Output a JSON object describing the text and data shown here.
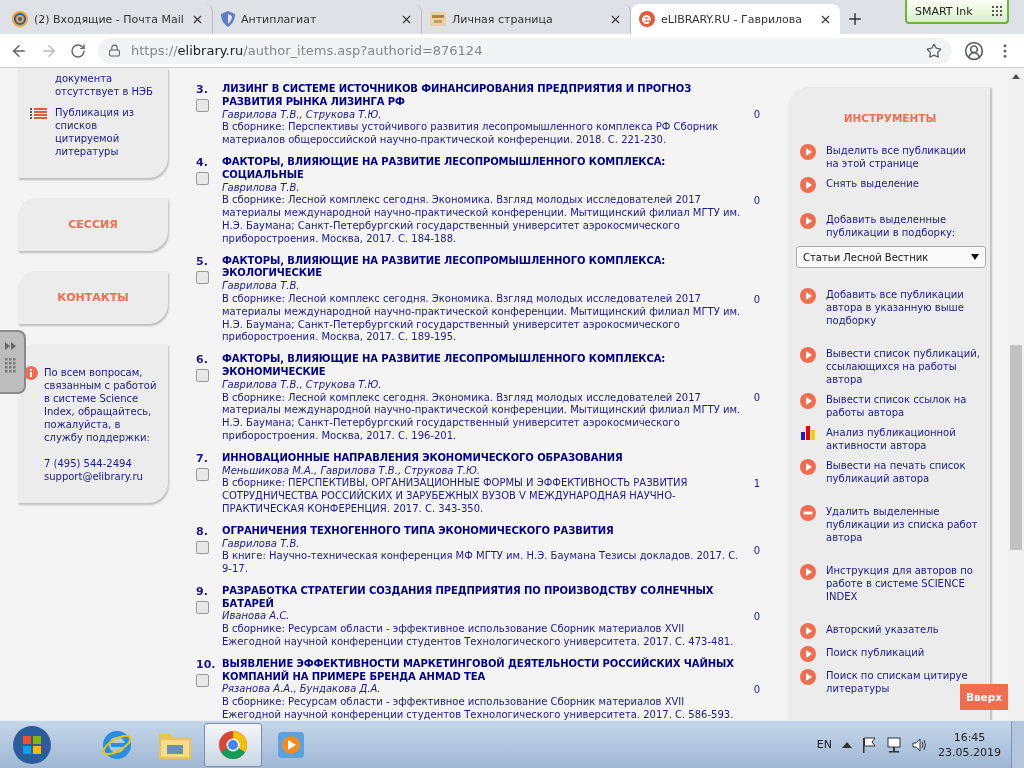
{
  "browser": {
    "tabs": [
      {
        "title": "(2) Входящие - Почта Mail",
        "kind": "mail",
        "selected": false
      },
      {
        "title": "Антиплагиат",
        "kind": "shield",
        "selected": false
      },
      {
        "title": "Личная страница",
        "kind": "image",
        "selected": false
      },
      {
        "title": "eLIBRARY.RU - Гаврилова",
        "kind": "elibrary",
        "selected": true
      }
    ],
    "url": {
      "scheme": "https://",
      "host": "elibrary.ru",
      "path": "/author_items.asp?authorid=876124"
    }
  },
  "smart_ink": {
    "label": "SMART Ink"
  },
  "sidebar": {
    "legend": [
      {
        "kind": "text",
        "text": "документа отсутствует в НЭБ"
      },
      {
        "kind": "list",
        "text": "Публикация из списков цитируемой литературы"
      }
    ],
    "menu": [
      {
        "label": "СЕССИЯ"
      },
      {
        "label": "КОНТАКТЫ"
      }
    ],
    "support": {
      "text": "По всем вопросам, связанным с работой в системе Science Index, обращайтесь, пожалуйста, в службу поддержки:",
      "phone": "7 (495) 544-2494",
      "email": "support@elibrary.ru"
    }
  },
  "publications": [
    {
      "number": "3.",
      "title": "ЛИЗИНГ В СИСТЕМЕ ИСТОЧНИКОВ ФИНАНСИРОВАНИЯ ПРЕДПРИЯТИЯ И ПРОГНОЗ РАЗВИТИЯ РЫНКА ЛИЗИНГА РФ",
      "authors": "Гаврилова Т.В., Струкова Т.Ю.",
      "source": "В сборнике: Перспективы устойчивого развития лесопромышленного комплекса РФ Сборник материалов общероссийской научно-практической конференции. 2018. С. 221-230.",
      "citations": "0",
      "checked": false
    },
    {
      "number": "4.",
      "title": "ФАКТОРЫ, ВЛИЯЮЩИЕ НА РАЗВИТИЕ ЛЕСОПРОМЫШЛЕННОГО КОМПЛЕКСА: СОЦИАЛЬНЫЕ",
      "authors": "Гаврилова Т.В.",
      "source": "В сборнике: Лесной комплекс сегодня. Экономика. Взгляд молодых исследователей 2017 материалы международной научно-практической конференции. Мытищинский филиал МГТУ им. Н.Э. Баумана; Санкт-Петербургский государственный университет аэрокосмического приборостроения. Москва, 2017. С. 184-188.",
      "citations": "0",
      "checked": false
    },
    {
      "number": "5.",
      "title": "ФАКТОРЫ, ВЛИЯЮЩИЕ НА РАЗВИТИЕ ЛЕСОПРОМЫШЛЕННОГО КОМПЛЕКСА: ЭКОЛОГИЧЕСКИЕ",
      "authors": "Гаврилова Т.В.",
      "source": "В сборнике: Лесной комплекс сегодня. Экономика. Взгляд молодых исследователей 2017 материалы международной научно-практической конференции. Мытищинский филиал МГТУ им. Н.Э. Баумана; Санкт-Петербургский государственный университет аэрокосмического приборостроения. Москва, 2017. С. 189-195.",
      "citations": "0",
      "checked": false
    },
    {
      "number": "6.",
      "title": "ФАКТОРЫ, ВЛИЯЮЩИЕ НА РАЗВИТИЕ ЛЕСОПРОМЫШЛЕННОГО КОМПЛЕКСА: ЭКОНОМИЧЕСКИЕ",
      "authors": "Гаврилова Т.В., Струкова Т.Ю.",
      "source": "В сборнике: Лесной комплекс сегодня. Экономика. Взгляд молодых исследователей 2017 материалы международной научно-практической конференции. Мытищинский филиал МГТУ им. Н.Э. Баумана; Санкт-Петербургский государственный университет аэрокосмического приборостроения. Москва, 2017. С. 196-201.",
      "citations": "0",
      "checked": false
    },
    {
      "number": "7.",
      "title": "ИННОВАЦИОННЫЕ НАПРАВЛЕНИЯ ЭКОНОМИЧЕСКОГО ОБРАЗОВАНИЯ",
      "authors": "Меньшикова М.А., Гаврилова Т.В., Струкова Т.Ю.",
      "source": "В сборнике: ПЕРСПЕКТИВЫ, ОРГАНИЗАЦИОННЫЕ ФОРМЫ И ЭФФЕКТИВНОСТЬ РАЗВИТИЯ СОТРУДНИЧЕСТВА РОССИЙСКИХ И ЗАРУБЕЖНЫХ ВУЗОВ V МЕЖДУНАРОДНАЯ НАУЧНО-ПРАКТИЧЕСКАЯ КОНФЕРЕНЦИЯ. 2017. С. 343-350.",
      "citations": "1",
      "checked": false
    },
    {
      "number": "8.",
      "title": "ОГРАНИЧЕНИЯ ТЕХНОГЕННОГО ТИПА ЭКОНОМИЧЕСКОГО РАЗВИТИЯ",
      "authors": "Гаврилова Т.В.",
      "source": "В книге: Научно-техническая конференция МФ МГТУ им. Н.Э. Баумана Тезисы докладов. 2017. С. 9-17.",
      "citations": "0",
      "checked": false
    },
    {
      "number": "9.",
      "title": "РАЗРАБОТКА СТРАТЕГИИ СОЗДАНИЯ ПРЕДПРИЯТИЯ ПО ПРОИЗВОДСТВУ СОЛНЕЧНЫХ БАТАРЕЙ",
      "authors": "Иванова А.С.",
      "source": "В сборнике: Ресурсам области - эффективное использование Сборник материалов XVII Ежегодной научной конференции студентов Технологического университета. 2017. С. 473-481.",
      "citations": "0",
      "checked": false
    },
    {
      "number": "10.",
      "title": "ВЫЯВЛЕНИЕ ЭФФЕКТИВНОСТИ МАРКЕТИНГОВОЙ ДЕЯТЕЛЬНОСТИ РОССИЙСКИХ ЧАЙНЫХ КОМПАНИЙ НА ПРИМЕРЕ БРЕНДА AHMAD TEA",
      "authors": "Рязанова А.А., Бундакова Д.А.",
      "source": "В сборнике: Ресурсам области - эффективное использование Сборник материалов XVII Ежегодной научной конференции студентов Технологического университета. 2017. С. 586-593.",
      "citations": "0",
      "checked": false
    }
  ],
  "tools": {
    "title": "ИНСТРУМЕНТЫ",
    "groups": [
      {
        "items": [
          {
            "kind": "play",
            "text": "Выделить все публикации на этой странице"
          },
          {
            "kind": "play",
            "text": "Снять выделение"
          }
        ]
      },
      {
        "items": [
          {
            "kind": "play",
            "text": "Добавить выделенные публикации в подборку:"
          },
          {
            "kind": "select",
            "text": "Статьи Лесной Вестник"
          }
        ]
      },
      {
        "items": [
          {
            "kind": "play",
            "text": "Добавить все публикации автора в указанную выше подборку"
          }
        ]
      },
      {
        "items": [
          {
            "kind": "play",
            "text": "Вывести список публикаций, ссылающихся на работы автора"
          },
          {
            "kind": "play",
            "text": "Вывести список ссылок на работы автора"
          },
          {
            "kind": "chart",
            "text": "Анализ публикационной активности автора"
          },
          {
            "kind": "play",
            "text": "Вывести на печать список публикаций автора"
          }
        ]
      },
      {
        "items": [
          {
            "kind": "minus",
            "text": "Удалить выделенные публикации из списка работ автора"
          }
        ]
      },
      {
        "items": [
          {
            "kind": "play",
            "text": "Инструкция для авторов по работе в системе SCIENCE INDEX"
          }
        ]
      },
      {
        "items": [
          {
            "kind": "play",
            "text": "Авторский указатель"
          },
          {
            "kind": "play",
            "text": "Поиск публикаций"
          },
          {
            "kind": "play",
            "text": "Поиск по спискам цитируе\nлитературы"
          }
        ]
      }
    ]
  },
  "scroll_top_button": "Вверх",
  "taskbar": {
    "apps": [
      {
        "kind": "ie",
        "selected": false
      },
      {
        "kind": "folder",
        "selected": false
      },
      {
        "kind": "chrome",
        "selected": true
      },
      {
        "kind": "player",
        "selected": false
      }
    ],
    "language": "EN",
    "time": "16:45",
    "date": "23.05.2019"
  }
}
